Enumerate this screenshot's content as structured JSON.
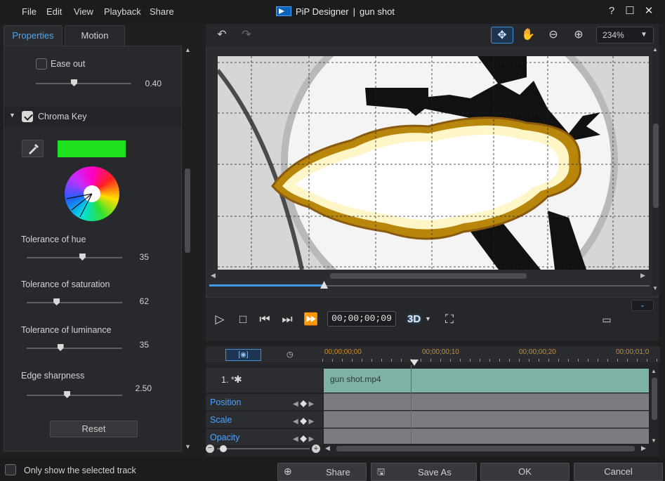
{
  "window": {
    "app_name": "PiP Designer",
    "separator": "|",
    "document": "gun shot",
    "controls": {
      "help": "?",
      "maximize": "☐",
      "close": "✕"
    }
  },
  "menu": [
    "File",
    "Edit",
    "View",
    "Playback",
    "Share"
  ],
  "tabs": {
    "properties": "Properties",
    "motion": "Motion"
  },
  "properties": {
    "ease_out": {
      "label": "Ease out",
      "checked": false,
      "value": "0.40",
      "fraction": 0.4
    },
    "chroma_key": {
      "label": "Chroma Key",
      "checked": true,
      "key_color": "#1ee01e",
      "tolerance_hue": {
        "label": "Tolerance of hue",
        "value": "35",
        "fraction": 0.58
      },
      "tolerance_saturation": {
        "label": "Tolerance of saturation",
        "value": "62",
        "fraction": 0.31
      },
      "tolerance_luminance": {
        "label": "Tolerance of luminance",
        "value": "35",
        "fraction": 0.35
      },
      "edge_sharpness": {
        "label": "Edge sharpness",
        "value": "2.50",
        "fraction": 0.42
      },
      "reset": "Reset"
    }
  },
  "preview": {
    "zoom": "234%",
    "playhead_fraction": 0.26
  },
  "transport": {
    "timecode": "00;00;00;09",
    "mode_3d": "3D"
  },
  "timeline": {
    "ruler": [
      "00;00;00;00",
      "00;00;00;10",
      "00;00;00;20",
      "00;00;01;0"
    ],
    "track": {
      "label": "1. *",
      "clip_name": "gun shot.mp4"
    },
    "keyframe_tracks": [
      "Position",
      "Scale",
      "Opacity"
    ]
  },
  "footer": {
    "only_selected": {
      "label": "Only show the selected track",
      "checked": false
    },
    "share": "Share",
    "save_as": "Save As",
    "ok": "OK",
    "cancel": "Cancel"
  },
  "colors": {
    "accent": "#4ea6f0",
    "timecode_marker": "#c98d2e",
    "clip": "#7fb2a6",
    "playhead": "#e0322a"
  }
}
